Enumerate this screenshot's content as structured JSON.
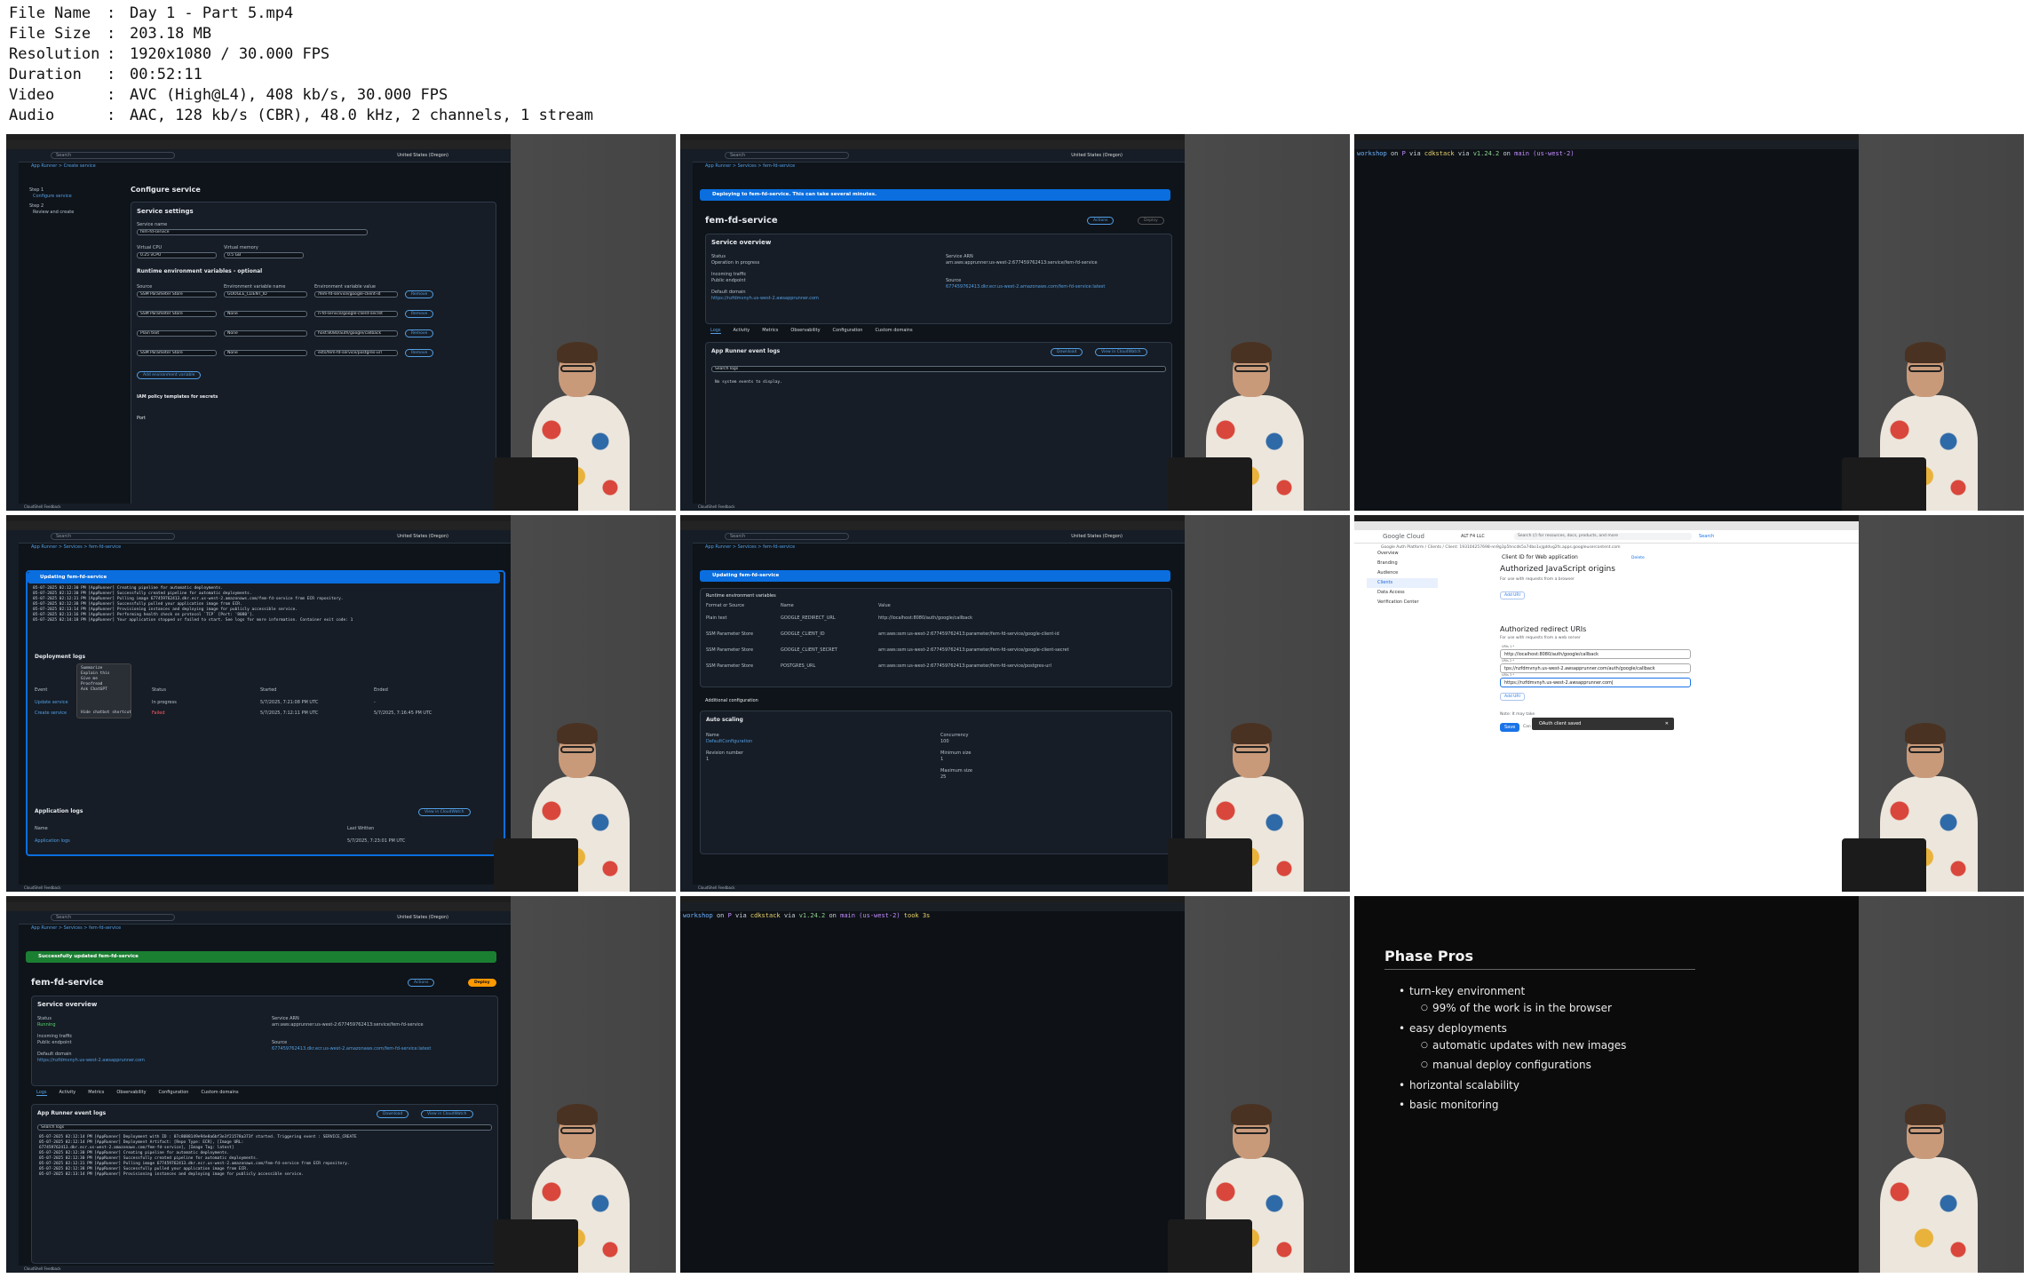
{
  "meta": {
    "rows": [
      {
        "key": "File Name",
        "value": "Day 1 - Part 5.mp4"
      },
      {
        "key": "File Size",
        "value": "203.18 MB"
      },
      {
        "key": "Resolution",
        "value": "1920x1080 / 30.000 FPS"
      },
      {
        "key": "Duration",
        "value": "00:52:11"
      },
      {
        "key": "Video",
        "value": "AVC (High@L4), 408 kb/s, 30.000 FPS"
      },
      {
        "key": "Audio",
        "value": "AAC, 128 kb/s (CBR), 48.0 kHz, 2 channels, 1 stream"
      }
    ]
  },
  "aws": {
    "search": "Search",
    "region": "United States (Oregon)",
    "footer": "CloudShell   Feedback"
  },
  "t1": {
    "crumb": "App Runner  >  Create service",
    "title": "Configure service",
    "step1": "Step 1",
    "step1_label": "Configure service",
    "step2": "Step 2",
    "step2_label": "Review and create",
    "settings": "Service settings",
    "name_label": "Service name",
    "name_value": "fem-fd-service",
    "cpu_label": "Virtual CPU",
    "cpu_value": "0.25 vCPU",
    "mem_label": "Virtual memory",
    "mem_value": "0.5 GB",
    "env_title": "Runtime environment variables - optional",
    "col_source": "Source",
    "col_name": "Environment variable name",
    "col_value": "Environment variable value",
    "rows": [
      {
        "source": "SSM Parameter Store",
        "name": "GOOGLE_CLIENT_ID",
        "value": "/fem-fd-service/google-client-id"
      },
      {
        "source": "SSM Parameter Store",
        "name": "None",
        "value": "n-fd-service/google-client-secret"
      },
      {
        "source": "Plain text",
        "name": "None",
        "value": "host:8080/auth/google/callback"
      },
      {
        "source": "SSM Parameter Store",
        "name": "None",
        "value": "ests/fem-fd-service/postgres-url"
      }
    ],
    "remove": "Remove",
    "add_env": "Add environment variable",
    "iam": "IAM policy templates for secrets",
    "port": "Port"
  },
  "t2": {
    "crumb": "App Runner  >  Services  >  fem-fd-service",
    "banner": "Deploying to fem-fd-service. This can take several minutes.",
    "title": "fem-fd-service",
    "actions": "Actions",
    "deploy": "Deploy",
    "overview": "Service overview",
    "status_label": "Status",
    "status_value": "Operation in progress",
    "arn_label": "Service ARN",
    "arn_value": "arn:aws:apprunner:us-west-2:677459762413:service/fem-fd-service",
    "traffic_label": "Incoming traffic",
    "traffic_value": "Public endpoint",
    "domain_label": "Default domain",
    "domain_value": "https://nzfdmvnyh.us-west-2.awsapprunner.com",
    "source_label": "Source",
    "source_value": "677459762413.dkr.ecr.us-west-2.amazonaws.com/fem-fd-service:latest",
    "tabs": [
      "Logs",
      "Activity",
      "Metrics",
      "Observability",
      "Configuration",
      "Custom domains"
    ],
    "logs_title": "App Runner event logs",
    "download": "Download",
    "cloudwatch": "View in CloudWatch",
    "search_logs": "Search logs",
    "empty": "No system events to display."
  },
  "t3": {
    "prompt": [
      "workshop",
      "on",
      "P",
      "via",
      "cdkstack",
      "via",
      "v1.24.2",
      "on",
      "main (us-west-2)"
    ]
  },
  "t4": {
    "crumb": "App Runner  >  Services  >  fem-fd-service",
    "banner": "Updating fem-fd-service",
    "log_lines": [
      "05-07-2025 02:12:30 PM [AppRunner] Creating pipeline for automatic deployments.",
      "05-07-2025 02:12:30 PM [AppRunner] Successfully created pipeline for automatic deployments.",
      "05-07-2025 02:12:31 PM [AppRunner] Pulling image 677459762413.dkr.ecr.us-west-2.amazonaws.com/fem-fd-service from ECR repository.",
      "05-07-2025 02:12:38 PM [AppRunner] Successfully pulled your application image from ECR.",
      "05-07-2025 02:13:14 PM [AppRunner] Provisioning instances and deploying image for publicly accessible service.",
      "05-07-2025 02:13:16 PM [AppRunner] Performing health check on protocol `TCP` [Port: '8080'].",
      "05-07-2025 02:14:18 PM [AppRunner] Your application stopped or failed to start. See logs for more information.  Container exit code: 1"
    ],
    "deploy_logs": "Deployment logs",
    "col_event": "Event",
    "col_status": "Status",
    "col_started": "Started",
    "col_ended": "Ended",
    "rows": [
      {
        "event": "Update service",
        "status": "In progress",
        "started": "5/7/2025, 7:21:08 PM UTC",
        "ended": "-"
      },
      {
        "event": "Create service",
        "status": "Failed",
        "started": "5/7/2025, 7:12:11 PM UTC",
        "ended": "5/7/2025, 7:16:45 PM UTC"
      }
    ],
    "menu": [
      "Summarize",
      "Explain this",
      "Give me",
      "Proofread",
      "Ask ChatGPT",
      "Hide chatbot shortcut"
    ],
    "app_logs": "Application logs",
    "col_name": "Name",
    "col_written": "Last Written",
    "app_row": "Application logs",
    "app_row_time": "5/7/2025, 7:23:01 PM UTC",
    "cloudwatch": "View in CloudWatch"
  },
  "t5": {
    "banner": "Updating fem-fd-service",
    "env_title": "Runtime environment variables",
    "col_source": "Format or Source",
    "col_name": "Name",
    "col_value": "Value",
    "rows": [
      {
        "source": "Plain text",
        "name": "GOOGLE_REDIRECT_URL",
        "value": "http://localhost:8080/auth/google/callback"
      },
      {
        "source": "SSM Parameter Store",
        "name": "GOOGLE_CLIENT_ID",
        "value": "arn:aws:ssm:us-west-2:677459762413:parameter/fem-fd-service/google-client-id"
      },
      {
        "source": "SSM Parameter Store",
        "name": "GOOGLE_CLIENT_SECRET",
        "value": "arn:aws:ssm:us-west-2:677459762413:parameter/fem-fd-service/google-client-secret"
      },
      {
        "source": "SSM Parameter Store",
        "name": "POSTGRES_URL",
        "value": "arn:aws:ssm:us-west-2:677459762413:parameter/fem-fd-service/postgres-url"
      }
    ],
    "additional": "Additional configuration",
    "autoscaling": "Auto scaling",
    "name_label": "Name",
    "name_value": "DefaultConfiguration",
    "rev_label": "Revision number",
    "rev_value": "1",
    "conc_label": "Concurrency",
    "conc_value": "100",
    "min_label": "Minimum size",
    "min_value": "1",
    "max_label": "Maximum size",
    "max_value": "25"
  },
  "t6": {
    "logo": "Google Cloud",
    "project": "ALT F4 LLC",
    "search": "Search (/) for resources, docs, products, and more",
    "search_btn": "Search",
    "crumb": "Google Auth Platform  /  Clients  /  Client: 193104257698-nn9g3p5hncdk5a74bo1vjgddvg2fs.apps.googleusercontent.com",
    "side": [
      "Overview",
      "Branding",
      "Audience",
      "Clients",
      "Data Access",
      "Verification Center"
    ],
    "header": "Client ID for Web application",
    "delete": "Delete",
    "js_title": "Authorized JavaScript origins",
    "js_note": "For use with requests from a browser",
    "add_uri": "Add URI",
    "redir_title": "Authorized redirect URIs",
    "redir_note": "For use with requests from a web server",
    "uris": [
      {
        "label": "URIs 1 *",
        "value": "http://localhost:8080/auth/google/callback"
      },
      {
        "label": "URIs 2 *",
        "value": "tps://nzfdmvnyh.us-west-2.awsapprunner.com/auth/google/callback"
      },
      {
        "label": "URIs 3 *",
        "value": "https://nzfdmvnyh.us-west-2.awsapprunner.com|"
      }
    ],
    "note": "Note: It may take",
    "save": "Save",
    "cancel": "Can",
    "toast": "OAuth client saved",
    "toast_close": "✕"
  },
  "t7": {
    "crumb": "App Runner  >  Services  >  fem-fd-service",
    "banner": "Successfully updated fem-fd-service",
    "title": "fem-fd-service",
    "actions": "Actions",
    "deploy": "Deploy",
    "overview": "Service overview",
    "status_label": "Status",
    "status_value": "Running",
    "arn_label": "Service ARN",
    "arn_value": "arn:aws:apprunner:us-west-2:677459762413:service/fem-fd-service",
    "traffic_label": "Incoming traffic",
    "traffic_value": "Public endpoint",
    "domain_label": "Default domain",
    "domain_value": "https://nzfdmvnyh.us-west-2.awsapprunner.com",
    "source_label": "Source",
    "source_value": "677459762413.dkr.ecr.us-west-2.amazonaws.com/fem-fd-service:latest",
    "tabs": [
      "Logs",
      "Activity",
      "Metrics",
      "Observability",
      "Configuration",
      "Custom domains"
    ],
    "logs_title": "App Runner event logs",
    "download": "Download",
    "cloudwatch": "View in CloudWatch",
    "search_logs": "Search logs",
    "log_lines": [
      "05-07-2025 02:12:14 PM [AppRunner] Deployment with ID : 87c8088149e94e8a6bf3e3f21578a373f started. Triggering event : SERVICE_CREATE",
      "05-07-2025 02:12:14 PM [AppRunner] Deployment Artifact: [Repo Type: ECR], [Image URL:",
      "677459762413.dkr.ecr.us-west-2.amazonaws.com/fem-fd-service], [Image Tag: latest]",
      "05-07-2025 02:12:30 PM [AppRunner] Creating pipeline for automatic deployments.",
      "05-07-2025 02:12:30 PM [AppRunner] Successfully created pipeline for automatic deployments.",
      "05-07-2025 02:12:31 PM [AppRunner] Pulling image 677459762413.dkr.ecr.us-west-2.amazonaws.com/fem-fd-service from ECR repository.",
      "05-07-2025 02:12:38 PM [AppRunner] Successfully pulled your application image from ECR.",
      "05-07-2025 02:13:14 PM [AppRunner] Provisioning instances and deploying image for publicly accessible service."
    ]
  },
  "t8": {
    "prompt": [
      "workshop",
      "on",
      "P",
      "via",
      "cdkstack",
      "via",
      "v1.24.2",
      "on",
      "main (us-west-2)",
      "took 3s"
    ]
  },
  "t9": {
    "title": "Phase Pros",
    "items": [
      {
        "text": "turn-key environment",
        "level": 1
      },
      {
        "text": "99% of the work is in the browser",
        "level": 2
      },
      {
        "text": "easy deployments",
        "level": 1
      },
      {
        "text": "automatic updates with new images",
        "level": 2
      },
      {
        "text": "manual deploy configurations",
        "level": 2
      },
      {
        "text": "horizontal scalability",
        "level": 1
      },
      {
        "text": "basic monitoring",
        "level": 1
      }
    ]
  },
  "colors": {
    "aws_bg": "#0f141a",
    "aws_link": "#539fe5",
    "aws_orange": "#ff9900",
    "banner_blue": "#0a6edf",
    "banner_green": "#1b7f32",
    "gcp_blue": "#1a73e8"
  }
}
